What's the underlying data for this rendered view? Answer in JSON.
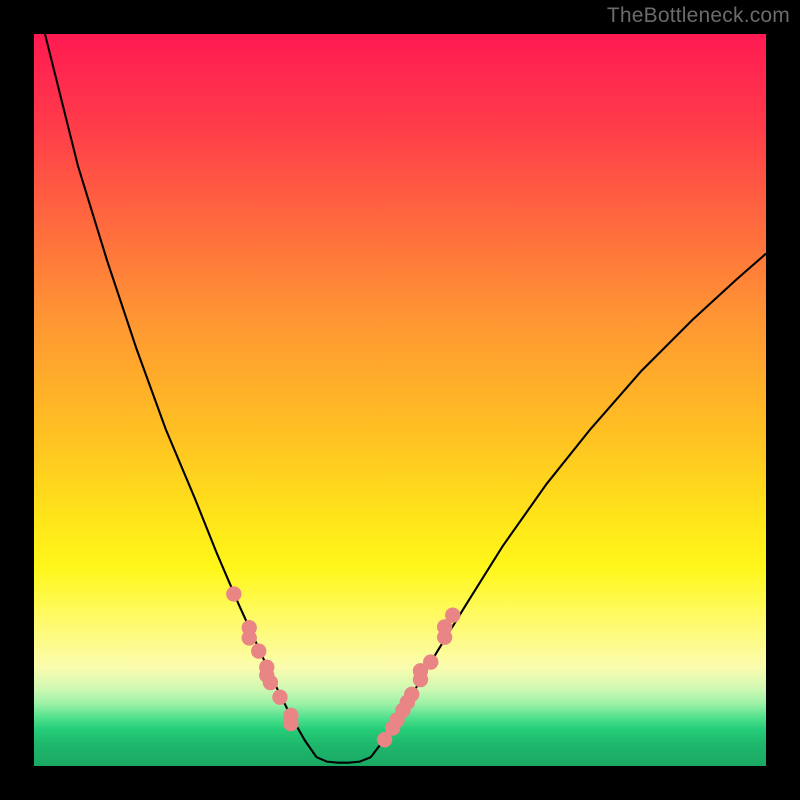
{
  "watermark": "TheBottleneck.com",
  "chart_data": {
    "type": "line",
    "title": "",
    "xlabel": "",
    "ylabel": "",
    "xlim": [
      0,
      100
    ],
    "ylim": [
      0,
      100
    ],
    "grid": false,
    "note": "Axis ticks and numeric labels are not shown in the image; x/y are normalized 0–100. Curve points are estimated from pixel positions.",
    "background_gradient": {
      "direction": "vertical",
      "stops": [
        {
          "pos": 0,
          "color": "#ff1a52"
        },
        {
          "pos": 12,
          "color": "#ff3a4a"
        },
        {
          "pos": 26,
          "color": "#ff6a3e"
        },
        {
          "pos": 38,
          "color": "#ff9334"
        },
        {
          "pos": 55,
          "color": "#ffc222"
        },
        {
          "pos": 66,
          "color": "#ffe41a"
        },
        {
          "pos": 73,
          "color": "#fff71a"
        },
        {
          "pos": 79,
          "color": "#fffa5e"
        },
        {
          "pos": 86.5,
          "color": "#fbfcae"
        },
        {
          "pos": 89.5,
          "color": "#cef8b3"
        },
        {
          "pos": 91.5,
          "color": "#9cf1a6"
        },
        {
          "pos": 93.5,
          "color": "#4de08c"
        },
        {
          "pos": 95,
          "color": "#25cd79"
        },
        {
          "pos": 97,
          "color": "#1fb86d"
        },
        {
          "pos": 100,
          "color": "#1aa862"
        }
      ]
    },
    "series": [
      {
        "name": "curve-left",
        "color": "#000000",
        "x": [
          0.5,
          3,
          6,
          10,
          14,
          18,
          22,
          25,
          28,
          30.5,
          33,
          35,
          37,
          38.6
        ],
        "y": [
          104,
          94,
          82,
          69,
          57,
          46,
          36.5,
          29,
          22,
          16.5,
          11,
          7,
          3.5,
          1.2
        ]
      },
      {
        "name": "curve-flat",
        "color": "#000000",
        "x": [
          38.6,
          40,
          41.5,
          43,
          44.5,
          46
        ],
        "y": [
          1.2,
          0.6,
          0.45,
          0.45,
          0.6,
          1.2
        ]
      },
      {
        "name": "curve-right",
        "color": "#000000",
        "x": [
          46,
          48.5,
          51.5,
          55,
          59,
          64,
          70,
          76,
          83,
          90,
          96,
          100
        ],
        "y": [
          1.2,
          4.5,
          9.5,
          15.5,
          22,
          30,
          38.5,
          46,
          54,
          61,
          66.5,
          70
        ]
      },
      {
        "name": "markers-left",
        "type": "scatter",
        "color": "#e98584",
        "marker_radius_pct": 1.05,
        "x": [
          27.3,
          29.4,
          29.4,
          30.7,
          31.8,
          31.8,
          32.3,
          33.6,
          35.1,
          35.1
        ],
        "y": [
          23.5,
          18.9,
          17.5,
          15.7,
          13.5,
          12.4,
          11.4,
          9.4,
          6.9,
          5.8
        ]
      },
      {
        "name": "markers-right",
        "type": "scatter",
        "color": "#e98584",
        "marker_radius_pct": 1.05,
        "x": [
          47.9,
          49.0,
          49.6,
          50.4,
          51.0,
          51.6,
          52.8,
          52.8,
          54.2,
          56.1,
          56.1,
          57.2
        ],
        "y": [
          3.6,
          5.2,
          6.3,
          7.6,
          8.7,
          9.8,
          11.8,
          13.0,
          14.2,
          17.6,
          19.0,
          20.6
        ]
      }
    ]
  }
}
